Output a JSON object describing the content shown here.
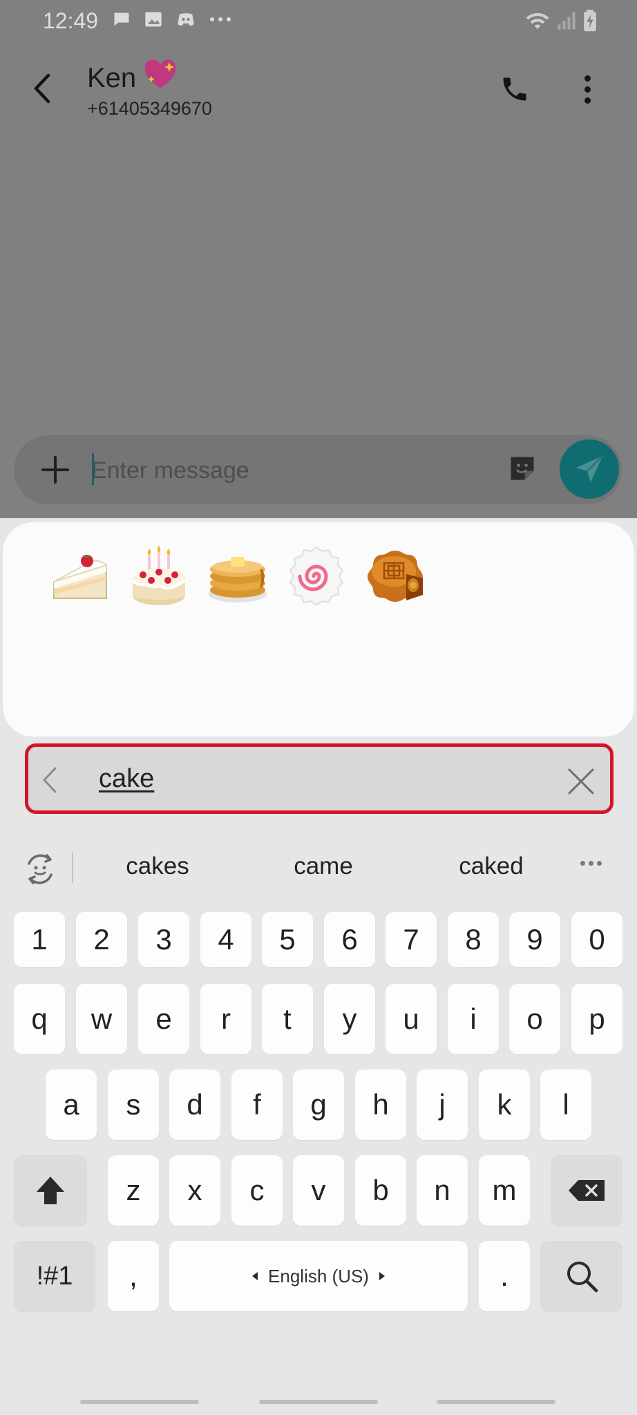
{
  "status_bar": {
    "time": "12:49",
    "left_icons": [
      "chat-bubble-icon",
      "image-icon",
      "discord-icon",
      "more-dots-icon"
    ],
    "right_icons": [
      "wifi-icon",
      "signal-icon",
      "battery-charging-icon"
    ]
  },
  "conversation": {
    "contact_name": "Ken",
    "contact_emoji": "sparkling-heart-icon",
    "contact_number": "+61405349670"
  },
  "composer": {
    "placeholder": "Enter message"
  },
  "emoji_results": {
    "items": [
      "shortcake",
      "birthday-cake",
      "pancakes",
      "fish-cake",
      "moon-cake"
    ]
  },
  "emoji_search": {
    "query": "cake",
    "highlight_color": "#d4142a"
  },
  "suggestions": {
    "words": [
      "cakes",
      "came",
      "caked"
    ]
  },
  "keyboard": {
    "number_row": [
      "1",
      "2",
      "3",
      "4",
      "5",
      "6",
      "7",
      "8",
      "9",
      "0"
    ],
    "row1": [
      "q",
      "w",
      "e",
      "r",
      "t",
      "y",
      "u",
      "i",
      "o",
      "p"
    ],
    "row2": [
      "a",
      "s",
      "d",
      "f",
      "g",
      "h",
      "j",
      "k",
      "l"
    ],
    "row3": [
      "z",
      "x",
      "c",
      "v",
      "b",
      "n",
      "m"
    ],
    "symbols_key": "!#1",
    "comma_key": ",",
    "period_key": ".",
    "space_label": "English (US)"
  },
  "colors": {
    "accent": "#0f6c70",
    "dim_overlay": "#808080"
  }
}
